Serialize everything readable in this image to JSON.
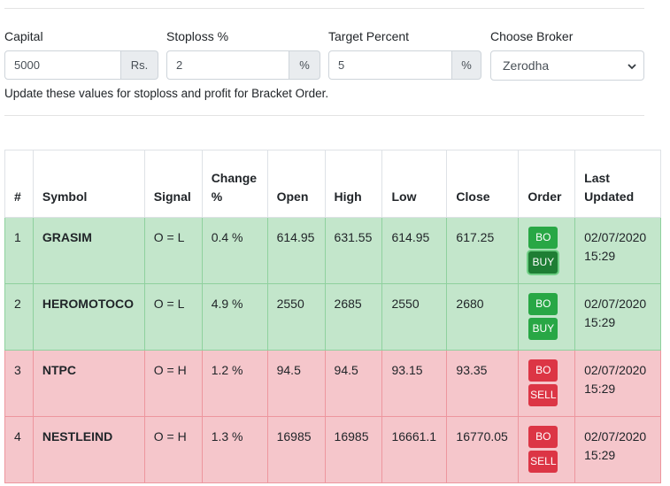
{
  "form": {
    "capital": {
      "label": "Capital",
      "value": "5000",
      "addon": "Rs."
    },
    "stoploss": {
      "label": "Stoploss %",
      "value": "2",
      "addon": "%"
    },
    "target": {
      "label": "Target Percent",
      "value": "5",
      "addon": "%"
    },
    "broker": {
      "label": "Choose Broker",
      "selected": "Zerodha",
      "icon": "chevron-down-icon"
    },
    "help_text": "Update these values for stoploss and profit for Bracket Order."
  },
  "table": {
    "headers": {
      "num": "#",
      "symbol": "Symbol",
      "signal": "Signal",
      "change_1": "Change",
      "change_2": "%",
      "open": "Open",
      "high": "High",
      "low": "Low",
      "close": "Close",
      "order": "Order",
      "updated_1": "Last",
      "updated_2": "Updated"
    },
    "rows": [
      {
        "num": "1",
        "symbol": "GRASIM",
        "signal": "O = L",
        "change": "0.4 %",
        "open": "614.95",
        "high": "631.55",
        "low": "614.95",
        "close": "617.25",
        "bo": "BO",
        "action": "BUY",
        "date": "02/07/2020",
        "time": "15:29",
        "status_color": "#c3e6cb"
      },
      {
        "num": "2",
        "symbol": "HEROMOTOCO",
        "signal": "O = L",
        "change": "4.9 %",
        "open": "2550",
        "high": "2685",
        "low": "2550",
        "close": "2680",
        "bo": "BO",
        "action": "BUY",
        "date": "02/07/2020",
        "time": "15:29",
        "status_color": "#c3e6cb"
      },
      {
        "num": "3",
        "symbol": "NTPC",
        "signal": "O = H",
        "change": "1.2 %",
        "open": "94.5",
        "high": "94.5",
        "low": "93.15",
        "close": "93.35",
        "bo": "BO",
        "action": "SELL",
        "date": "02/07/2020",
        "time": "15:29",
        "status_color": "#f5c6cb"
      },
      {
        "num": "4",
        "symbol": "NESTLEIND",
        "signal": "O = H",
        "change": "1.3 %",
        "open": "16985",
        "high": "16985",
        "low": "16661.1",
        "close": "16770.05",
        "bo": "BO",
        "action": "SELL",
        "date": "02/07/2020",
        "time": "15:29",
        "status_color": "#f5c6cb"
      }
    ]
  },
  "colors": {
    "buy": "#28a745",
    "buy_active": "#1e7e34",
    "sell": "#dc3545"
  }
}
